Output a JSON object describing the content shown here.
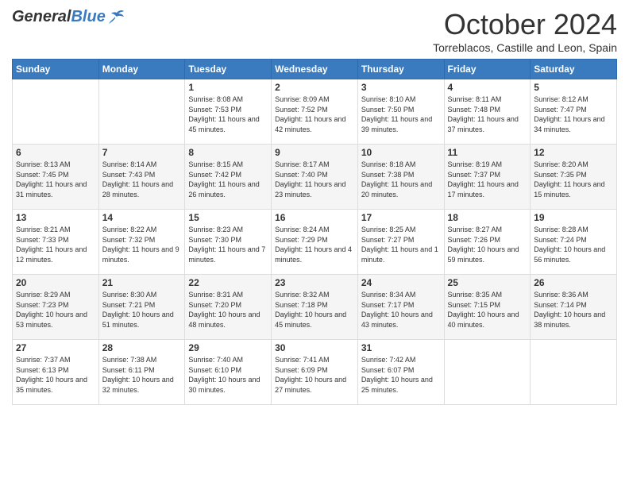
{
  "header": {
    "logo_general": "General",
    "logo_blue": "Blue",
    "month_title": "October 2024",
    "subtitle": "Torreblacos, Castille and Leon, Spain"
  },
  "days_of_week": [
    "Sunday",
    "Monday",
    "Tuesday",
    "Wednesday",
    "Thursday",
    "Friday",
    "Saturday"
  ],
  "weeks": [
    [
      {
        "day": "",
        "info": ""
      },
      {
        "day": "",
        "info": ""
      },
      {
        "day": "1",
        "info": "Sunrise: 8:08 AM\nSunset: 7:53 PM\nDaylight: 11 hours and 45 minutes."
      },
      {
        "day": "2",
        "info": "Sunrise: 8:09 AM\nSunset: 7:52 PM\nDaylight: 11 hours and 42 minutes."
      },
      {
        "day": "3",
        "info": "Sunrise: 8:10 AM\nSunset: 7:50 PM\nDaylight: 11 hours and 39 minutes."
      },
      {
        "day": "4",
        "info": "Sunrise: 8:11 AM\nSunset: 7:48 PM\nDaylight: 11 hours and 37 minutes."
      },
      {
        "day": "5",
        "info": "Sunrise: 8:12 AM\nSunset: 7:47 PM\nDaylight: 11 hours and 34 minutes."
      }
    ],
    [
      {
        "day": "6",
        "info": "Sunrise: 8:13 AM\nSunset: 7:45 PM\nDaylight: 11 hours and 31 minutes."
      },
      {
        "day": "7",
        "info": "Sunrise: 8:14 AM\nSunset: 7:43 PM\nDaylight: 11 hours and 28 minutes."
      },
      {
        "day": "8",
        "info": "Sunrise: 8:15 AM\nSunset: 7:42 PM\nDaylight: 11 hours and 26 minutes."
      },
      {
        "day": "9",
        "info": "Sunrise: 8:17 AM\nSunset: 7:40 PM\nDaylight: 11 hours and 23 minutes."
      },
      {
        "day": "10",
        "info": "Sunrise: 8:18 AM\nSunset: 7:38 PM\nDaylight: 11 hours and 20 minutes."
      },
      {
        "day": "11",
        "info": "Sunrise: 8:19 AM\nSunset: 7:37 PM\nDaylight: 11 hours and 17 minutes."
      },
      {
        "day": "12",
        "info": "Sunrise: 8:20 AM\nSunset: 7:35 PM\nDaylight: 11 hours and 15 minutes."
      }
    ],
    [
      {
        "day": "13",
        "info": "Sunrise: 8:21 AM\nSunset: 7:33 PM\nDaylight: 11 hours and 12 minutes."
      },
      {
        "day": "14",
        "info": "Sunrise: 8:22 AM\nSunset: 7:32 PM\nDaylight: 11 hours and 9 minutes."
      },
      {
        "day": "15",
        "info": "Sunrise: 8:23 AM\nSunset: 7:30 PM\nDaylight: 11 hours and 7 minutes."
      },
      {
        "day": "16",
        "info": "Sunrise: 8:24 AM\nSunset: 7:29 PM\nDaylight: 11 hours and 4 minutes."
      },
      {
        "day": "17",
        "info": "Sunrise: 8:25 AM\nSunset: 7:27 PM\nDaylight: 11 hours and 1 minute."
      },
      {
        "day": "18",
        "info": "Sunrise: 8:27 AM\nSunset: 7:26 PM\nDaylight: 10 hours and 59 minutes."
      },
      {
        "day": "19",
        "info": "Sunrise: 8:28 AM\nSunset: 7:24 PM\nDaylight: 10 hours and 56 minutes."
      }
    ],
    [
      {
        "day": "20",
        "info": "Sunrise: 8:29 AM\nSunset: 7:23 PM\nDaylight: 10 hours and 53 minutes."
      },
      {
        "day": "21",
        "info": "Sunrise: 8:30 AM\nSunset: 7:21 PM\nDaylight: 10 hours and 51 minutes."
      },
      {
        "day": "22",
        "info": "Sunrise: 8:31 AM\nSunset: 7:20 PM\nDaylight: 10 hours and 48 minutes."
      },
      {
        "day": "23",
        "info": "Sunrise: 8:32 AM\nSunset: 7:18 PM\nDaylight: 10 hours and 45 minutes."
      },
      {
        "day": "24",
        "info": "Sunrise: 8:34 AM\nSunset: 7:17 PM\nDaylight: 10 hours and 43 minutes."
      },
      {
        "day": "25",
        "info": "Sunrise: 8:35 AM\nSunset: 7:15 PM\nDaylight: 10 hours and 40 minutes."
      },
      {
        "day": "26",
        "info": "Sunrise: 8:36 AM\nSunset: 7:14 PM\nDaylight: 10 hours and 38 minutes."
      }
    ],
    [
      {
        "day": "27",
        "info": "Sunrise: 7:37 AM\nSunset: 6:13 PM\nDaylight: 10 hours and 35 minutes."
      },
      {
        "day": "28",
        "info": "Sunrise: 7:38 AM\nSunset: 6:11 PM\nDaylight: 10 hours and 32 minutes."
      },
      {
        "day": "29",
        "info": "Sunrise: 7:40 AM\nSunset: 6:10 PM\nDaylight: 10 hours and 30 minutes."
      },
      {
        "day": "30",
        "info": "Sunrise: 7:41 AM\nSunset: 6:09 PM\nDaylight: 10 hours and 27 minutes."
      },
      {
        "day": "31",
        "info": "Sunrise: 7:42 AM\nSunset: 6:07 PM\nDaylight: 10 hours and 25 minutes."
      },
      {
        "day": "",
        "info": ""
      },
      {
        "day": "",
        "info": ""
      }
    ]
  ]
}
